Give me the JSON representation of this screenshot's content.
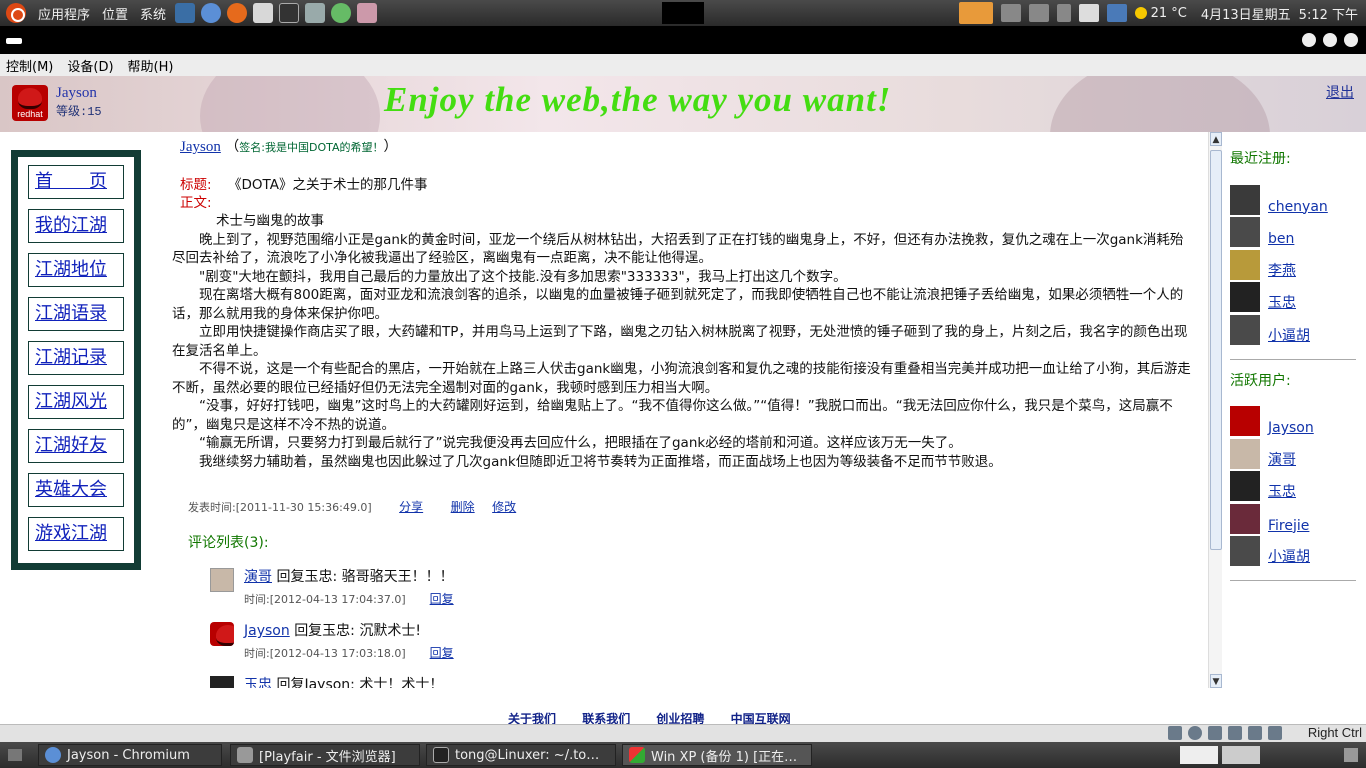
{
  "topPanel": {
    "menus": [
      "应用程序",
      "位置",
      "系统"
    ],
    "temperature": "21 °C",
    "date": "4月13日星期五",
    "time": "5:12 下午"
  },
  "vmMenu": [
    "控制(M)",
    "设备(D)",
    "帮助(H)"
  ],
  "header": {
    "username": "Jayson",
    "level": "等级:15",
    "slogan": "Enjoy the web,the way you want!",
    "logout": "退出",
    "avatar_text": "redhat"
  },
  "leftNav": [
    "首　　页",
    "我的江湖",
    "江湖地位",
    "江湖语录",
    "江湖记录",
    "江湖风光",
    "江湖好友",
    "英雄大会",
    "游戏江湖"
  ],
  "post": {
    "author": "Jayson",
    "signature": "签名:我是中国DOTA的希望！",
    "title_label": "标题:",
    "title": "《DOTA》之关于术士的那几件事",
    "body_label": "正文:",
    "paragraphs": [
      "术士与幽鬼的故事",
      "晚上到了，视野范围缩小正是gank的黄金时间，亚龙一个绕后从树林钻出，大招丢到了正在打钱的幽鬼身上，不好，但还有办法挽救，复仇之魂在上一次gank消耗殆尽回去补给了，流浪吃了小净化被我逼出了经验区，离幽鬼有一点距离，决不能让他得逞。",
      "\"剧变\"大地在颤抖，我用自己最后的力量放出了这个技能.没有多加思索\"333333\"，我马上打出这几个数字。",
      "现在离塔大概有800距离，面对亚龙和流浪剑客的追杀，以幽鬼的血量被锤子砸到就死定了，而我即使牺牲自己也不能让流浪把锤子丢给幽鬼，如果必须牺牲一个人的话，那么就用我的身体来保护你吧。",
      "立即用快捷键操作商店买了眼，大药罐和TP，并用鸟马上运到了下路，幽鬼之刃钻入树林脱离了视野，无处泄愤的锤子砸到了我的身上，片刻之后，我名字的颜色出现在复活名单上。",
      "不得不说，这是一个有些配合的黑店，一开始就在上路三人伏击gank幽鬼，小狗流浪剑客和复仇之魂的技能衔接没有重叠相当完美并成功把一血让给了小狗，其后游走不断，虽然必要的眼位已经插好但仍无法完全遏制对面的gank，我顿时感到压力相当大啊。",
      "“没事，好好打钱吧，幽鬼”这时鸟上的大药罐刚好运到，给幽鬼贴上了。“我不值得你这么做。”“值得！”我脱口而出。“我无法回应你什么，我只是个菜鸟，这局赢不的”，幽鬼只是这样不冷不热的说道。",
      "“输赢无所谓，只要努力打到最后就行了”说完我便没再去回应什么，把眼插在了gank必经的塔前和河道。这样应该万无一失了。",
      "我继续努力辅助着，虽然幽鬼也因此躲过了几次gank但随即近卫将节奏转为正面推塔，而正面战场上也因为等级装备不足而节节败退。"
    ],
    "meta": "发表时间:[2011-11-30 15:36:49.0]",
    "share": "分享",
    "delete": "删除",
    "edit": "修改"
  },
  "comments": {
    "title": "评论列表(3):",
    "reply_label": "回复",
    "items": [
      {
        "who": "演哥",
        "text": "回复玉忠: 骆哥骆天王！！！",
        "time": "时间:[2012-04-13 17:04:37.0]"
      },
      {
        "who": "Jayson",
        "text": "回复玉忠: 沉默术士!",
        "time": "时间:[2012-04-13 17:03:18.0]"
      },
      {
        "who": "玉忠",
        "text": "回复Jayson: 术士！术士！",
        "time": ""
      }
    ]
  },
  "sidebar": {
    "recent_title": "最近注册:",
    "recent": [
      "chenyan",
      "ben",
      "李燕",
      "玉忠",
      "小逼胡"
    ],
    "active_title": "活跃用户:",
    "active": [
      "Jayson",
      "演哥",
      "玉忠",
      "Firejie",
      "小逼胡"
    ]
  },
  "footer": [
    "关于我们",
    "联系我们",
    "创业招聘",
    "中国互联网"
  ],
  "vmStatus": {
    "host_key": "Right Ctrl"
  },
  "taskbar": [
    {
      "label": "Jayson - Chromium"
    },
    {
      "label": "[Playfair - 文件浏览器]"
    },
    {
      "label": "tong@Linuxer: ~/.to…"
    },
    {
      "label": "Win XP (备份 1) [正在…"
    }
  ]
}
